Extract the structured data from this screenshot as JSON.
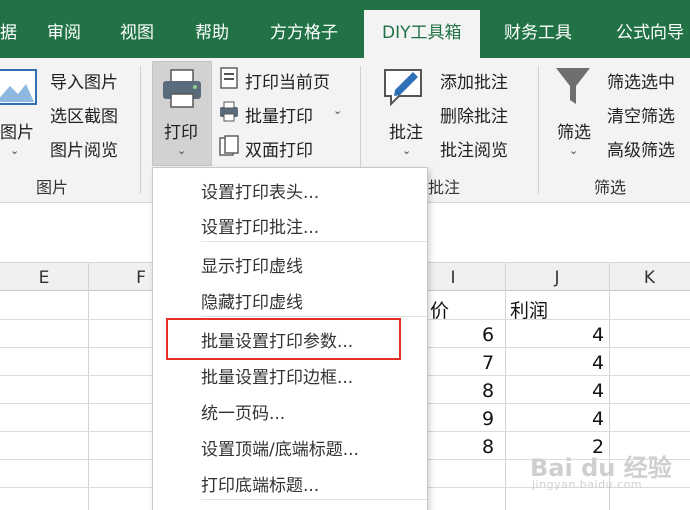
{
  "tabs": [
    "据",
    "审阅",
    "视图",
    "帮助",
    "方方格子",
    "DIY工具箱",
    "财务工具",
    "公式向导"
  ],
  "ribbon": {
    "picture_group": {
      "big_button": "图片",
      "items": [
        "导入图片",
        "选区截图",
        "图片阅览"
      ],
      "label": "图片"
    },
    "print_group": {
      "big_button": "打印",
      "items": [
        "打印当前页",
        "批量打印",
        "双面打印"
      ]
    },
    "comment_group": {
      "big_button": "批注",
      "items": [
        "添加批注",
        "删除批注",
        "批注阅览"
      ],
      "label": "批注"
    },
    "filter_group": {
      "big_button": "筛选",
      "items": [
        "筛选选中",
        "清空筛选",
        "高级筛选"
      ],
      "label": "筛选"
    }
  },
  "sheet": {
    "columns": [
      "E",
      "F",
      "I",
      "J",
      "K"
    ],
    "header_row": [
      "价",
      "利润"
    ],
    "rows": [
      {
        "i": "6",
        "j": "4"
      },
      {
        "i": "7",
        "j": "4"
      },
      {
        "i": "8",
        "j": "4"
      },
      {
        "i": "9",
        "j": "4"
      },
      {
        "i": "8",
        "j": "2"
      }
    ]
  },
  "menu": {
    "items": [
      "设置打印表头...",
      "设置打印批注...",
      "显示打印虚线",
      "隐藏打印虚线",
      "批量设置打印参数...",
      "批量设置打印边框...",
      "统一页码...",
      "设置顶端/底端标题...",
      "打印底端标题..."
    ],
    "highlighted_item": "批量设置打印参数..."
  },
  "watermark": {
    "main": "Bai du 经验",
    "sub": "jingyan.baidu.com"
  },
  "colors": {
    "accent": "#217346",
    "highlight_box": "#e53025"
  }
}
